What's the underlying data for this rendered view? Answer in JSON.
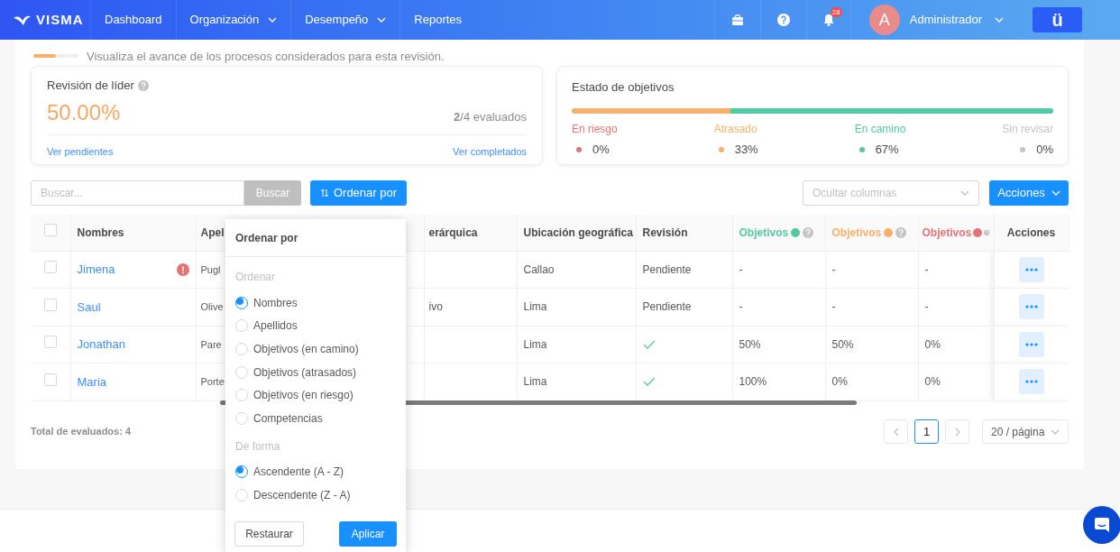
{
  "nav": {
    "logo": "VISMA",
    "items": [
      {
        "label": "Dashboard",
        "dropdown": false
      },
      {
        "label": "Organización",
        "dropdown": true
      },
      {
        "label": "Desempeño",
        "dropdown": true
      },
      {
        "label": "Reportes",
        "dropdown": false
      }
    ],
    "notifications": "28",
    "avatar": "A",
    "user": "Administrador",
    "app_button": "ü"
  },
  "progress": {
    "level": 0.5,
    "description": "Visualiza el avance de los procesos considerados para esta revisión."
  },
  "leader_card": {
    "title": "Revisión de líder",
    "value": "50.00%",
    "count": "**2**/4 evaluados",
    "links": [
      "Ver pendientes",
      "Ver completados"
    ]
  },
  "status_card": {
    "title": "Estado de objetivos",
    "items": [
      {
        "label": "En riesgo",
        "value": "0%",
        "color": "#e57373"
      },
      {
        "label": "Atrasado",
        "value": "33%",
        "color": "#f5b06b",
        "level": 0.33
      },
      {
        "label": "En camino",
        "value": "67%",
        "color": "#52c9a5",
        "level": 0.67
      },
      {
        "label": "Sin revisar",
        "value": "0%",
        "color": "#c4c4c4"
      }
    ]
  },
  "toolbar": {
    "search_placeholder": "Buscar...",
    "search_button": "Buscar",
    "sort_button": "Ordenar por",
    "columns_placeholder": "Ocultar columnas",
    "actions_button": "Acciones"
  },
  "table": {
    "select_all": {
      "checked": false
    },
    "columns": [
      {
        "label": "Nombres",
        "help": false
      },
      {
        "label": "Apel",
        "help": false
      },
      {
        "label": "erárquica",
        "help": false
      },
      {
        "label": "Ubicación geográfica",
        "help": false
      },
      {
        "label": "Revisión",
        "help": false
      },
      {
        "label": "Objetivos",
        "help": true,
        "color": "#52c9a5"
      },
      {
        "label": "Objetivos",
        "help": true,
        "color": "#f5b06b"
      },
      {
        "label": "Objetivos",
        "help": true,
        "color": "#e57373"
      },
      {
        "label": "Acciones",
        "help": false
      }
    ],
    "rows": [
      {
        "checked": false,
        "name": "Jimena",
        "alert": true,
        "surname": "Pugl",
        "column_3": "",
        "location": "Callao",
        "reviewed": false,
        "revision": "Pendiente",
        "on_track": "-",
        "delayed": "-",
        "at_risk": "-"
      },
      {
        "checked": false,
        "name": "Saul",
        "alert": false,
        "surname": "Olive",
        "column_3": "ivo",
        "location": "Lima",
        "reviewed": false,
        "revision": "Pendiente",
        "on_track": "-",
        "delayed": "-",
        "at_risk": "-"
      },
      {
        "checked": false,
        "name": "Jonathan",
        "alert": false,
        "surname": "Pare",
        "column_3": "",
        "location": "Lima",
        "reviewed": true,
        "on_track": "50%",
        "delayed": "50%",
        "at_risk": "0%"
      },
      {
        "checked": false,
        "name": "Maria",
        "alert": false,
        "surname": "Porte",
        "column_3": "",
        "location": "Lima",
        "reviewed": true,
        "on_track": "100%",
        "delayed": "0%",
        "at_risk": "0%"
      }
    ]
  },
  "footer": {
    "total": "Total de evaluados: 4",
    "page": "1",
    "page_size": "20 / página"
  },
  "sort_menu": {
    "title": "Ordenar por",
    "sections": [
      {
        "label": "Ordenar",
        "options": [
          {
            "label": "Nombres",
            "selected": true
          },
          {
            "label": "Apellidos",
            "selected": false
          },
          {
            "label": "Objetivos (en camino)",
            "selected": false
          },
          {
            "label": "Objetivos (atrasados)",
            "selected": false
          },
          {
            "label": "Objetivos (en riesgo)",
            "selected": false
          },
          {
            "label": "Competencias",
            "selected": false
          }
        ]
      },
      {
        "label": "De forma",
        "options": [
          {
            "label": "Ascendente (A - Z)",
            "selected": true
          },
          {
            "label": "Descendente (Z - A)",
            "selected": false
          }
        ]
      }
    ],
    "buttons": [
      "Restaurar",
      "Aplicar"
    ]
  }
}
